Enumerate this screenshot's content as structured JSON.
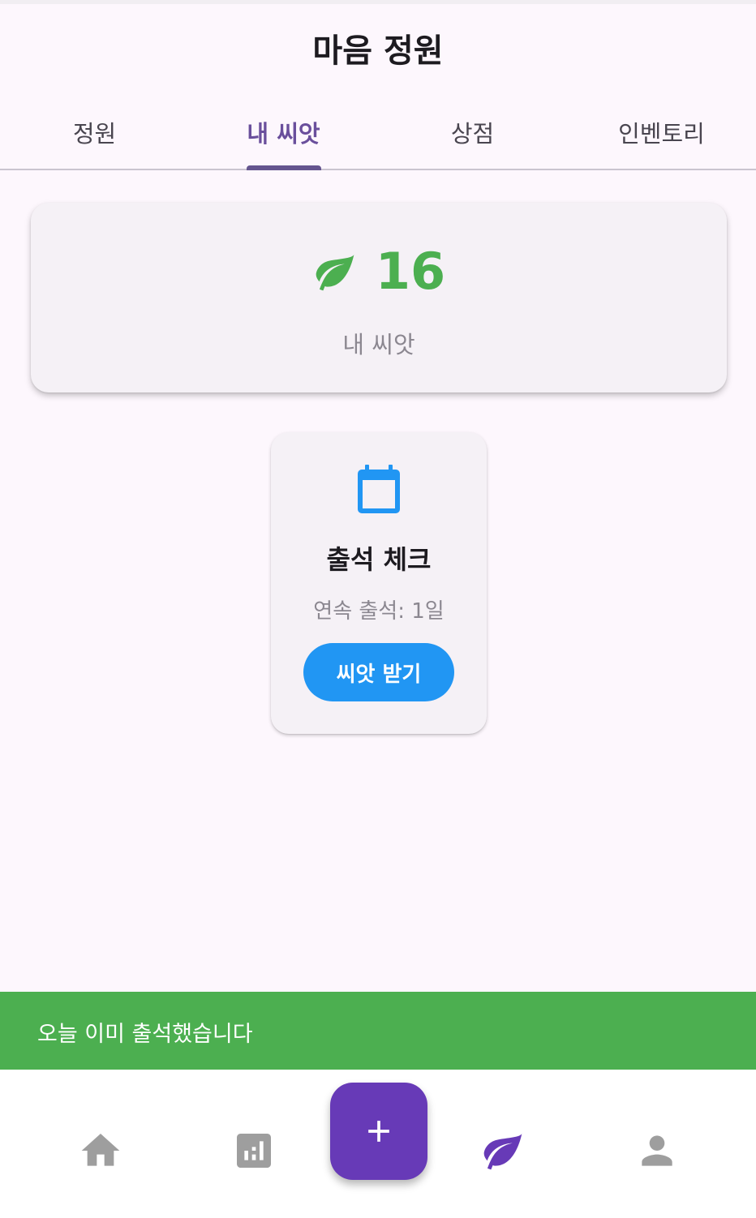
{
  "app": {
    "title": "마음 정원"
  },
  "tabs": [
    {
      "label": "정원",
      "active": false
    },
    {
      "label": "내 씨앗",
      "active": true
    },
    {
      "label": "상점",
      "active": false
    },
    {
      "label": "인벤토리",
      "active": false
    }
  ],
  "seeds": {
    "count": "16",
    "label": "내 씨앗",
    "icon": "leaf-icon",
    "color": "#4caf50"
  },
  "attendance": {
    "icon": "calendar-icon",
    "title": "출석 체크",
    "streak": "연속 출석: 1일",
    "button_label": "씨앗 받기",
    "button_color": "#2196f3"
  },
  "snackbar": {
    "message": "오늘 이미 출석했습니다",
    "color": "#4caf50"
  },
  "bottom_nav": {
    "items": [
      {
        "icon": "home-icon",
        "active": false
      },
      {
        "icon": "chart-icon",
        "active": false
      },
      {
        "icon": "add-icon",
        "fab": true
      },
      {
        "icon": "leaf-icon",
        "active": true
      },
      {
        "icon": "person-icon",
        "active": false
      }
    ],
    "active_color": "#673ab7",
    "inactive_color": "#9e9e9e"
  }
}
